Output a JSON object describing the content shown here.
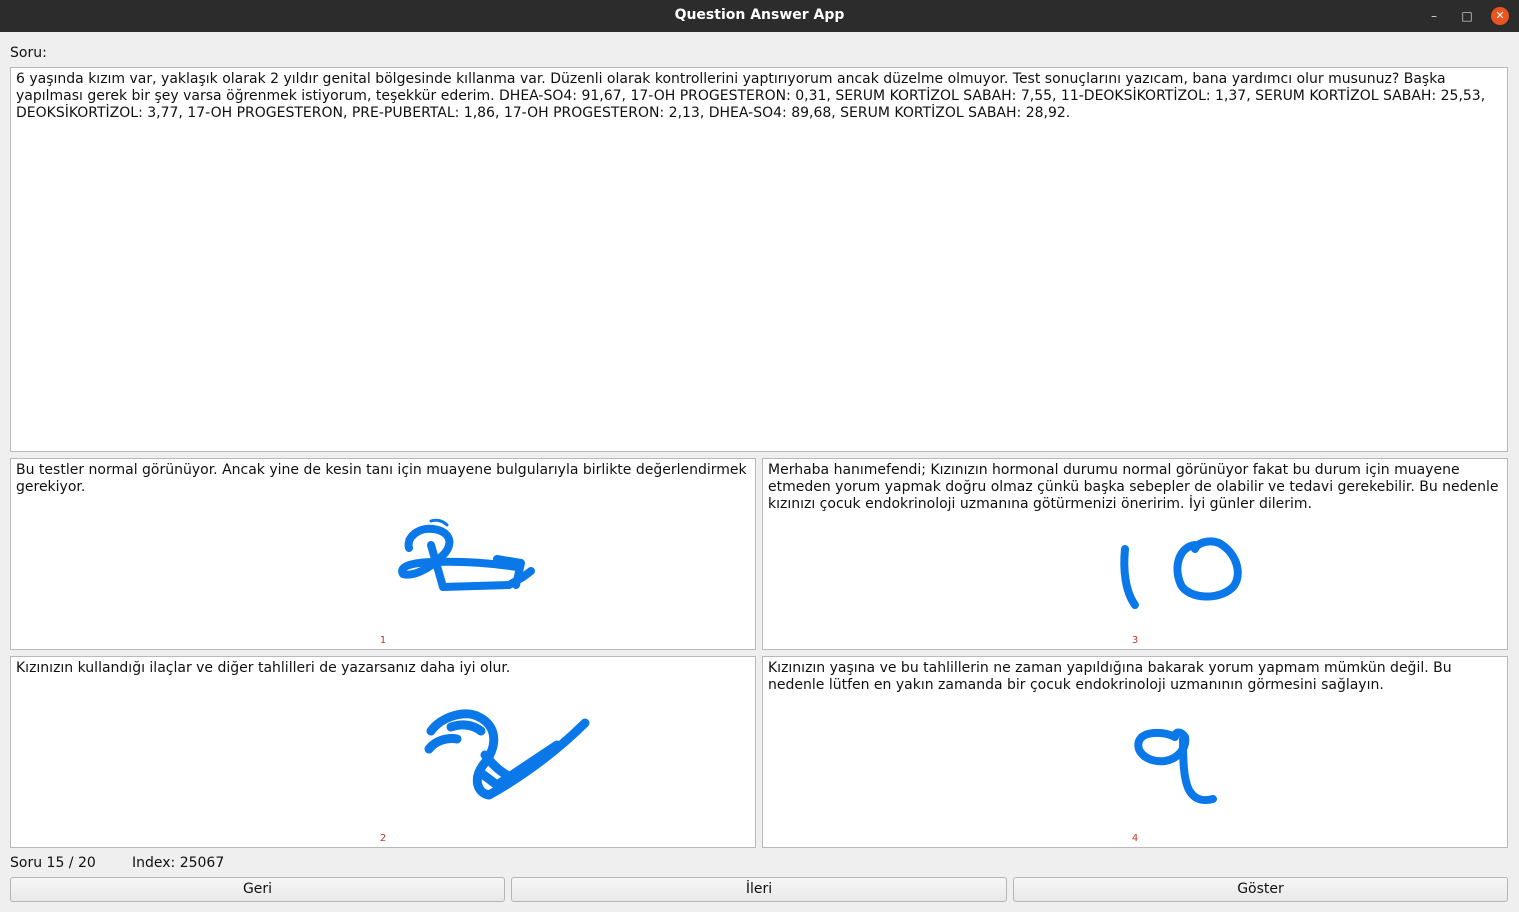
{
  "window": {
    "title": "Question Answer App",
    "minimize_glyph": "–",
    "maximize_glyph": "□",
    "close_glyph": "✕"
  },
  "question": {
    "label": "Soru:",
    "text": "6 yaşında kızım var, yaklaşık olarak 2 yıldır genital bölgesinde kıllanma var. Düzenli olarak kontrollerini yaptırıyorum ancak düzelme olmuyor. Test sonuçlarını yazıcam, bana yardımcı olur musunuz? Başka yapılması gerek bir şey varsa öğrenmek istiyorum, teşekkür ederim. DHEA-SO4: 91,67, 17-OH PROGESTERON: 0,31, SERUM KORTİZOL SABAH: 7,55, 11-DEOKSİKORTİZOL: 1,37, SERUM KORTİZOL SABAH: 25,53, DEOKSİKORTİZOL: 3,77, 17-OH PROGESTERON, PRE-PUBERTAL: 1,86, 17-OH PROGESTERON: 2,13, DHEA-SO4: 89,68, SERUM KORTİZOL SABAH: 28,92."
  },
  "answers": [
    {
      "text": "Bu testler normal görünüyor. Ancak yine de kesin tanı için muayene bulgularıyla birlikte değerlendirmek gerekiyor.",
      "number": "1",
      "handwritten_score": "2"
    },
    {
      "text": "Merhaba hanımefendi; Kızınızın hormonal durumu normal görünüyor fakat bu durum için muayene etmeden yorum yapmak doğru olmaz çünkü başka sebepler de olabilir ve tedavi gerekebilir. Bu nedenle kızınızı çocuk endokrinoloji uzmanına götürmenizi öneririm. İyi günler dilerim.",
      "number": "3",
      "handwritten_score": "10"
    },
    {
      "text": "Kızınızın kullandığı ilaçlar ve diğer tahlilleri de yazarsanız daha iyi olur.",
      "number": "2",
      "handwritten_score": "2"
    },
    {
      "text": "Kızınızın yaşına ve bu tahlillerin ne zaman yapıldığına bakarak yorum yapmam mümkün değil. Bu nedenle lütfen en yakın zamanda bir çocuk endokrinoloji uzmanının görmesini sağlayın.",
      "number": "4",
      "handwritten_score": "9"
    }
  ],
  "status": {
    "progress": "Soru 15 / 20",
    "index": "Index: 25067"
  },
  "buttons": {
    "back": "Geri",
    "next": "İleri",
    "show": "Göster"
  },
  "colors": {
    "scribble": "#0a78e8",
    "number": "#c0392b",
    "close_button": "#e95420"
  }
}
